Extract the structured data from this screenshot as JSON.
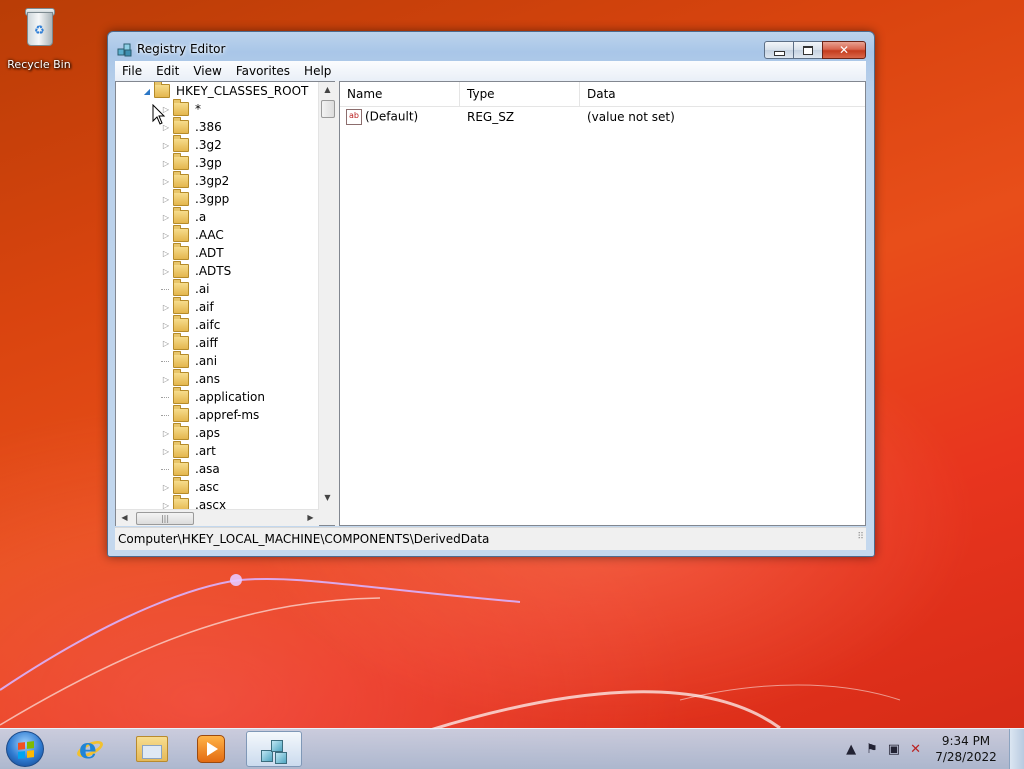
{
  "desktop": {
    "recycle_bin_label": "Recycle Bin"
  },
  "window": {
    "title": "Registry Editor",
    "menu": [
      "File",
      "Edit",
      "View",
      "Favorites",
      "Help"
    ],
    "tree": {
      "root": "HKEY_CLASSES_ROOT",
      "children": [
        {
          "label": "*",
          "expandable": true
        },
        {
          "label": ".386",
          "expandable": true
        },
        {
          "label": ".3g2",
          "expandable": true
        },
        {
          "label": ".3gp",
          "expandable": true
        },
        {
          "label": ".3gp2",
          "expandable": true
        },
        {
          "label": ".3gpp",
          "expandable": true
        },
        {
          "label": ".a",
          "expandable": true
        },
        {
          "label": ".AAC",
          "expandable": true
        },
        {
          "label": ".ADT",
          "expandable": true
        },
        {
          "label": ".ADTS",
          "expandable": true
        },
        {
          "label": ".ai",
          "expandable": false
        },
        {
          "label": ".aif",
          "expandable": true
        },
        {
          "label": ".aifc",
          "expandable": true
        },
        {
          "label": ".aiff",
          "expandable": true
        },
        {
          "label": ".ani",
          "expandable": false
        },
        {
          "label": ".ans",
          "expandable": true
        },
        {
          "label": ".application",
          "expandable": false
        },
        {
          "label": ".appref-ms",
          "expandable": false
        },
        {
          "label": ".aps",
          "expandable": true
        },
        {
          "label": ".art",
          "expandable": true
        },
        {
          "label": ".asa",
          "expandable": false
        },
        {
          "label": ".asc",
          "expandable": true
        },
        {
          "label": ".ascx",
          "expandable": true
        }
      ]
    },
    "list": {
      "columns": [
        "Name",
        "Type",
        "Data"
      ],
      "rows": [
        {
          "name": "(Default)",
          "type": "REG_SZ",
          "data": "(value not set)"
        }
      ]
    },
    "status": "Computer\\HKEY_LOCAL_MACHINE\\COMPONENTS\\DerivedData"
  },
  "taskbar": {
    "pinned": [
      "internet-explorer",
      "windows-explorer",
      "media-player",
      "registry-editor"
    ],
    "clock_time": "9:34 PM",
    "clock_date": "7/28/2022"
  },
  "colors": {
    "desktop_bg": "#e04a16",
    "window_frame": "#b9d0ea",
    "taskbar": "#b4c8e0"
  }
}
